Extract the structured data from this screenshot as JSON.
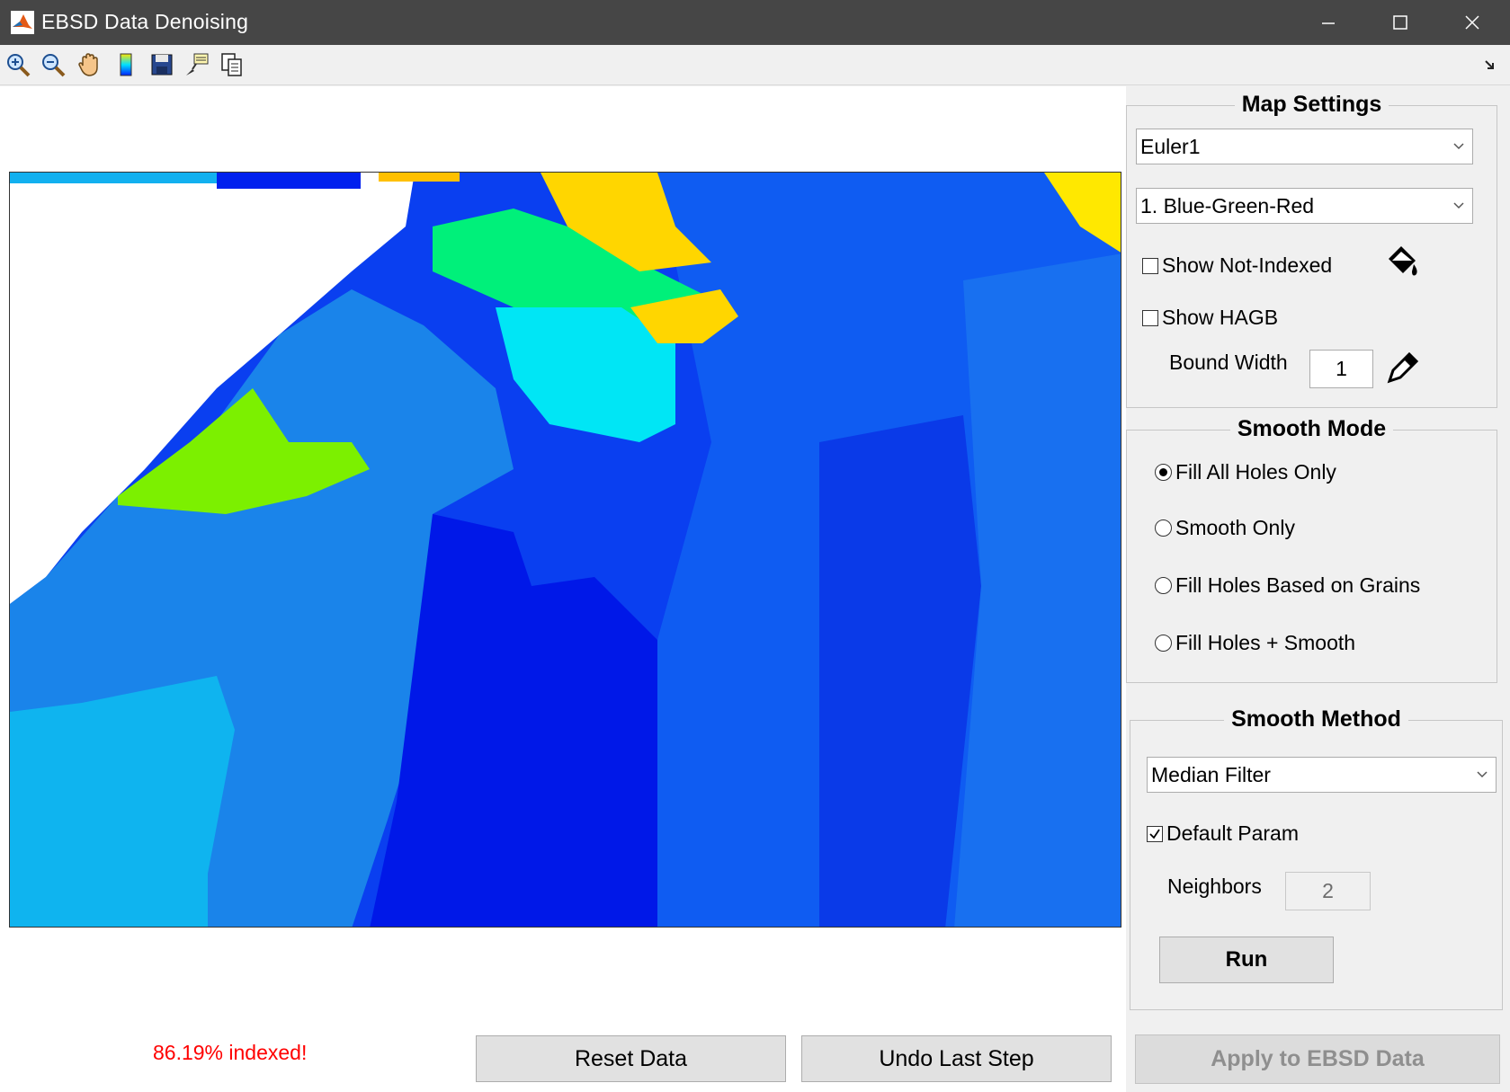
{
  "window": {
    "title": "EBSD Data Denoising"
  },
  "toolbar": {
    "tools": [
      "zoom-in-icon",
      "zoom-out-icon",
      "pan-hand-icon",
      "colorbar-icon",
      "save-icon",
      "data-cursor-icon",
      "copy-figure-icon"
    ]
  },
  "map": {
    "colormap": "Blue-Green-Red"
  },
  "status": {
    "indexed_text": "86.19% indexed!",
    "color": "#ff0000"
  },
  "buttons": {
    "reset": "Reset Data",
    "undo": "Undo Last Step",
    "run": "Run",
    "apply": "Apply to EBSD Data"
  },
  "map_settings": {
    "title": "Map Settings",
    "property_select": "Euler1",
    "colormap_select": "1. Blue-Green-Red",
    "show_not_indexed": {
      "label": "Show Not-Indexed",
      "checked": false
    },
    "show_hagb": {
      "label": "Show HAGB",
      "checked": false
    },
    "bound_width": {
      "label": "Bound Width",
      "value": "1"
    }
  },
  "smooth_mode": {
    "title": "Smooth Mode",
    "options": [
      {
        "label": "Fill All Holes Only",
        "selected": true
      },
      {
        "label": "Smooth Only",
        "selected": false
      },
      {
        "label": "Fill Holes Based on Grains",
        "selected": false
      },
      {
        "label": "Fill Holes + Smooth",
        "selected": false
      }
    ]
  },
  "smooth_method": {
    "title": "Smooth Method",
    "method_select": "Median Filter",
    "default_param": {
      "label": "Default Param",
      "checked": true
    },
    "neighbors": {
      "label": "Neighbors",
      "value": "2"
    }
  }
}
